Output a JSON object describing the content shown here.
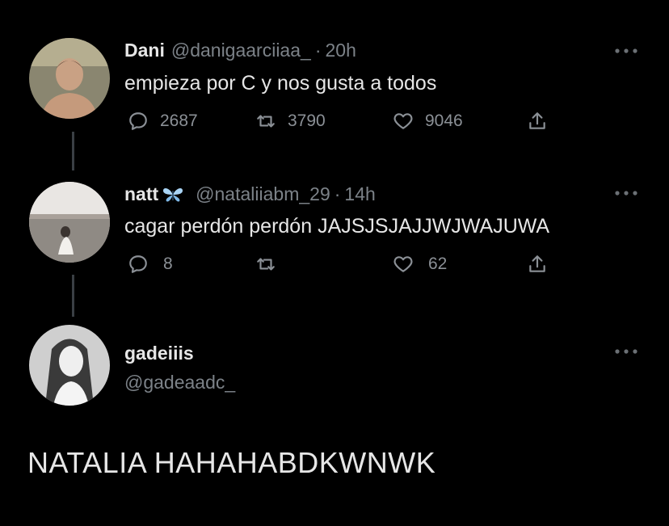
{
  "tweets": [
    {
      "name": "Dani",
      "handle": "@danigaarciiaa_",
      "time": "20h",
      "text": "empieza por C y nos gusta a todos",
      "replies": "2687",
      "retweets": "3790",
      "likes": "9046"
    },
    {
      "name": "natt",
      "badge_icon": "butterfly-icon",
      "handle": "@nataliiabm_29",
      "time": "14h",
      "text": "cagar perdón perdón JAJSJSJAJJWJWAJUWA",
      "replies": "8",
      "retweets": "",
      "likes": "62"
    }
  ],
  "main_tweet": {
    "name": "gadeiiis",
    "handle": "@gadeaadc_",
    "text": "NATALIA HAHAHABDKWNWK"
  },
  "separator_dot": "·",
  "colors": {
    "background": "#000000",
    "text": "#e6e6e6",
    "muted": "#7c8288",
    "thread_line": "#3a3f44",
    "butterfly": "#a9d4f5"
  }
}
